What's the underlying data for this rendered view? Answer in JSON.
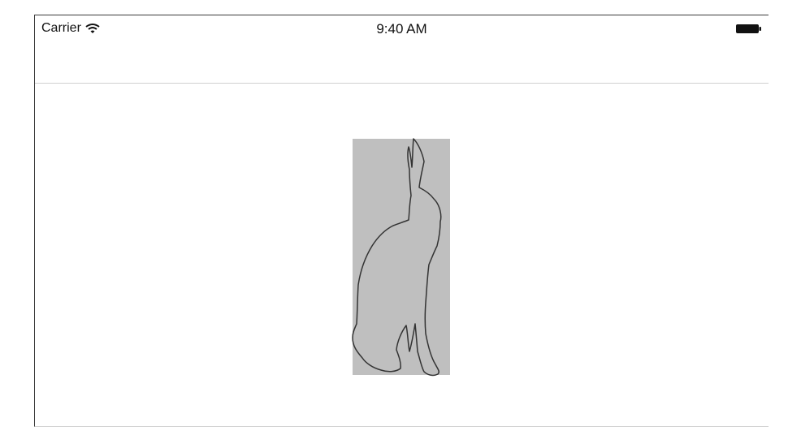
{
  "status_bar": {
    "carrier": "Carrier",
    "time": "9:40 AM",
    "wifi_icon": "wifi-icon",
    "battery_icon": "battery-icon"
  },
  "content": {
    "image": {
      "icon": "rabbit-silhouette-icon",
      "background_color": "#bfbfbf",
      "stroke_color": "#333333"
    }
  }
}
